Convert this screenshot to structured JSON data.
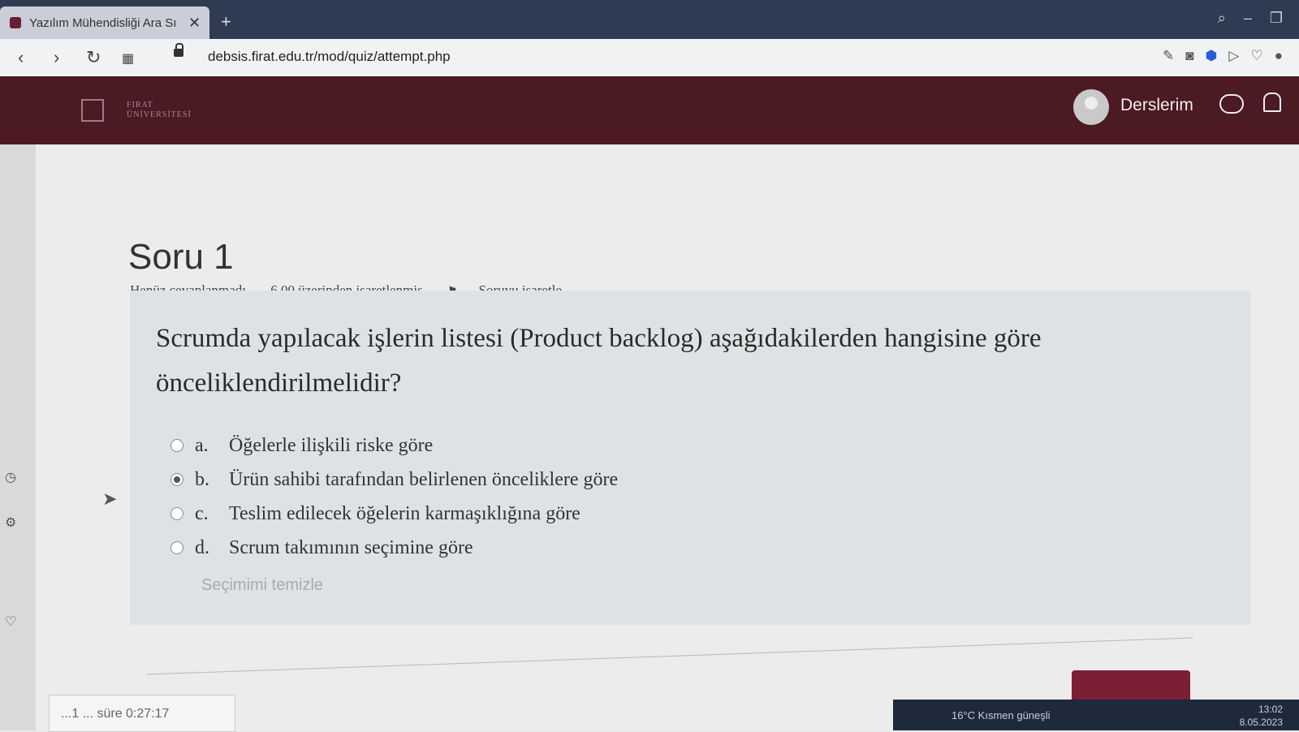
{
  "browser": {
    "tab_title": "Yazılım Mühendisliği Ara Sı",
    "url": "debsis.firat.edu.tr/mod/quiz/attempt.php"
  },
  "site": {
    "logo_line1": "FIRAT",
    "logo_line2": "ÜNİVERSİTESİ",
    "nav_label": "Derslerim"
  },
  "question": {
    "title": "Soru 1",
    "status": "Henüz cevaplanmadı",
    "marks": "6,00 üzerinden işaretlenmiş",
    "flag_label": "Soruyu işaretle",
    "text": "Scrumda yapılacak işlerin listesi (Product backlog) aşağıdakilerden hangisine göre önceliklendirilmelidir?",
    "answers": [
      {
        "letter": "a.",
        "text": "Öğelerle ilişkili riske göre"
      },
      {
        "letter": "b.",
        "text": "Ürün sahibi tarafından belirlenen önceliklere göre"
      },
      {
        "letter": "c.",
        "text": "Teslim edilecek öğelerin karmaşıklığına göre"
      },
      {
        "letter": "d.",
        "text": "Scrum takımının seçimine göre"
      }
    ],
    "selected": "b.",
    "clear_label": "Seçimimi temizle"
  },
  "timer": {
    "text": "...1 ... süre 0:27:17"
  },
  "taskbar": {
    "weather": "16°C  Kısmen güneşli",
    "time": "13:02",
    "date": "8.05.2023"
  },
  "colors": {
    "header": "#4b1a23",
    "accent": "#7c1e34"
  }
}
